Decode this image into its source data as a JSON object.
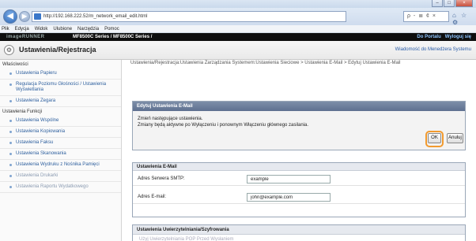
{
  "browser": {
    "address": "http://192.168.222.52/m_network_email_edit.html",
    "address_tools": "ρ - ≣ ¢ ×",
    "toolbar_icons": "⌂ ☆ ⚙",
    "nav_back": "◀",
    "nav_forward": "▶",
    "window_buttons": [
      "–",
      "□",
      "×"
    ]
  },
  "menu": [
    "Plik",
    "Edycja",
    "Widok",
    "Ulubione",
    "Narzędzia",
    "Pomoc"
  ],
  "device": {
    "logo": "imageRUNNER",
    "model": "MF8500C Series / MF8500C Series /",
    "portal": "Do Portalu",
    "logout": "Wyloguj się"
  },
  "header": {
    "title": "Ustawienia/Rejestracja",
    "sys_admin": "Wiadomość do Menedżera Systemu"
  },
  "sidebar": {
    "groups": [
      {
        "heading": "Właściwości",
        "items": [
          "Ustawienia Papieru",
          "Regulacja Poziomu Głośności / Ustawienia Wyświetlania",
          "Ustawienia Zegara"
        ]
      },
      {
        "heading": "Ustawienia Funkcji",
        "items": [
          "Ustawienia Wspólne",
          "Ustawienia Kopiowania",
          "Ustawienia Faksu",
          "Ustawienia Skanowania",
          "Ustawienia Wydruku z Nośnika Pamięci",
          "Ustawienia Drukarki",
          "Ustawienia Raportu Wydatkowego"
        ]
      }
    ]
  },
  "breadcrumb": "Ustawienia/Rejestracja:Ustawienia Zarządzania Systemem:Ustawienia Sieciowe > Ustawienia E-Mail > Edytuj Ustawienia E-Mail",
  "edit_panel": {
    "title": "Edytuj Ustawienia E-Mail",
    "message_line1": "Zmień następujące ustawienia.",
    "message_line2": "Zmiany będą aktywne po Wyłączeniu i ponownym Włączeniu głównego zasilania.",
    "ok_label": "OK",
    "cancel_label": "Anuluj"
  },
  "email_panel": {
    "title": "Ustawienia E-Mail",
    "fields": [
      {
        "label": "Adres Serwera SMTP:",
        "value": "example"
      },
      {
        "label": "Adres E-mail:",
        "value": "john@example.com"
      }
    ]
  },
  "auth_panel": {
    "title": "Ustawienia Uwierzytelniania/Szyfrowania",
    "line": "Użyj Uwierzytelniania POP Przed Wysłaniem"
  },
  "colors": {
    "accent_ring": "#f29a2e",
    "panel_header": "#5e7090",
    "link": "#2d5f9e"
  }
}
